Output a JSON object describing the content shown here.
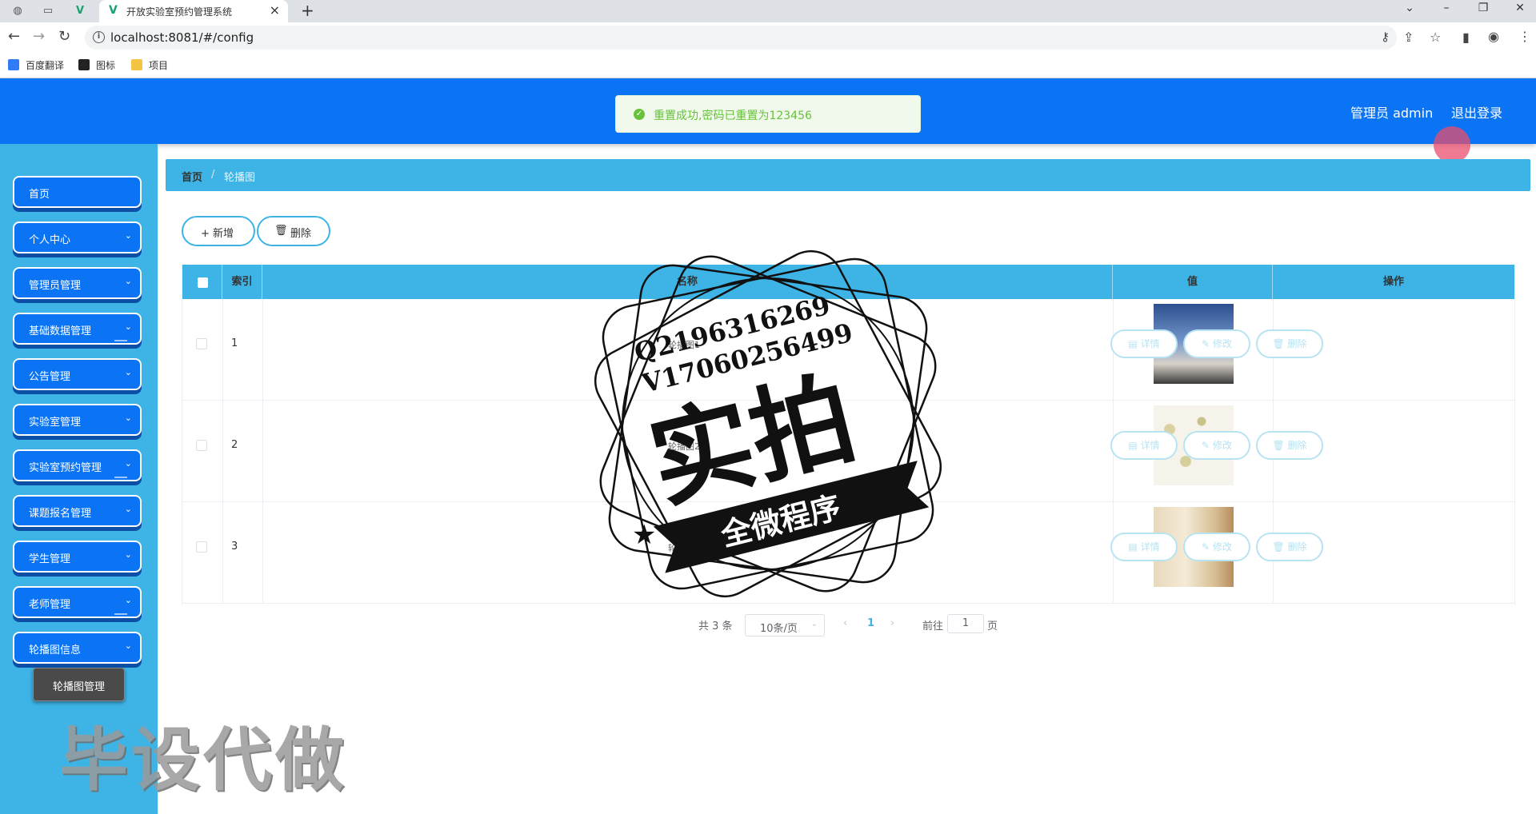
{
  "browser": {
    "tab_title": "开放实验室预约管理系统",
    "url": "localhost:8081/#/config",
    "bookmarks": [
      {
        "label": "百度翻译",
        "color": "#2f7cf6"
      },
      {
        "label": "图标",
        "color": "#222222"
      },
      {
        "label": "项目",
        "color": "#f4c542"
      }
    ]
  },
  "header": {
    "user_label": "管理员 admin",
    "logout_label": "退出登录"
  },
  "toast": {
    "message": "重置成功,密码已重置为123456"
  },
  "sidebar": {
    "items": [
      {
        "label": "首页",
        "has_children": false
      },
      {
        "label": "个人中心",
        "has_children": true
      },
      {
        "label": "管理员管理",
        "has_children": true
      },
      {
        "label": "基础数据管理",
        "has_children": true
      },
      {
        "label": "公告管理",
        "has_children": true
      },
      {
        "label": "实验室管理",
        "has_children": true
      },
      {
        "label": "实验室预约管理",
        "has_children": true
      },
      {
        "label": "课题报名管理",
        "has_children": true
      },
      {
        "label": "学生管理",
        "has_children": true
      },
      {
        "label": "老师管理",
        "has_children": true
      },
      {
        "label": "轮播图信息",
        "has_children": true
      }
    ],
    "submenu_label": "轮播图管理"
  },
  "breadcrumb": {
    "home": "首页",
    "separator": "/",
    "current": "轮播图"
  },
  "toolbar": {
    "add_label": "+ 新增",
    "delete_label": "删除"
  },
  "table": {
    "headers": {
      "index": "索引",
      "name": "名称",
      "value": "值",
      "actions": "操作"
    },
    "rows": [
      {
        "index": "1",
        "name": "轮播图1",
        "image": "sky"
      },
      {
        "index": "2",
        "name": "轮播图2",
        "image": "flowers"
      },
      {
        "index": "3",
        "name": "轮播图3",
        "image": "room"
      }
    ],
    "actions": {
      "detail": "详情",
      "edit": "修改",
      "delete": "删除"
    }
  },
  "pagination": {
    "total_label": "共 3 条",
    "page_size_label": "10条/页",
    "current_page": "1",
    "goto_label": "前往",
    "goto_value": "1",
    "page_unit": "页"
  },
  "watermark": {
    "qq": "Q2196316269",
    "vx": "V17060256499",
    "main": "实拍",
    "ribbon": "全微程序",
    "corner": "毕设代做"
  },
  "colors": {
    "header_blue": "#0a74f5",
    "sidebar_cyan": "#3db3e6",
    "success_green": "#67c23a"
  }
}
